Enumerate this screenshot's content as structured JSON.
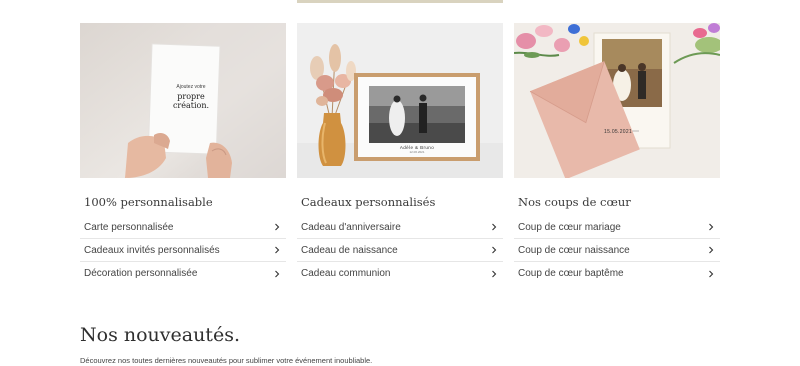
{
  "cards": [
    {
      "title": "100% personnalisable",
      "image_text": [
        "Ajoutez votre",
        "propre",
        "création."
      ],
      "links": [
        "Carte personnalisée",
        "Cadeaux invités personnalisés",
        "Décoration personnalisée"
      ]
    },
    {
      "title": "Cadeaux personnalisés",
      "image_text": [
        "Adèle & Bruno",
        "12.06.2021"
      ],
      "links": [
        "Cadeau d'anniversaire",
        "Cadeau de naissance",
        "Cadeau communion"
      ]
    },
    {
      "title": "Nos coups de cœur",
      "image_text": [
        "15.05.2021"
      ],
      "links": [
        "Coup de cœur mariage",
        "Coup de cœur naissance",
        "Coup de cœur baptême"
      ]
    }
  ],
  "section": {
    "title": "Nos nouveautés.",
    "description": "Découvrez nos toutes dernières nouveautés pour sublimer votre événement inoubliable."
  },
  "colors": {
    "card1_bg": "#e9e5e2",
    "card2_bg": "#eeeeee",
    "card3_bg": "#f0ece7",
    "envelope": "#e6b5a6",
    "frame_wood": "#c9a070",
    "accent_strip": "#d9d3bf"
  },
  "icons": [
    "chevron-right-icon"
  ]
}
